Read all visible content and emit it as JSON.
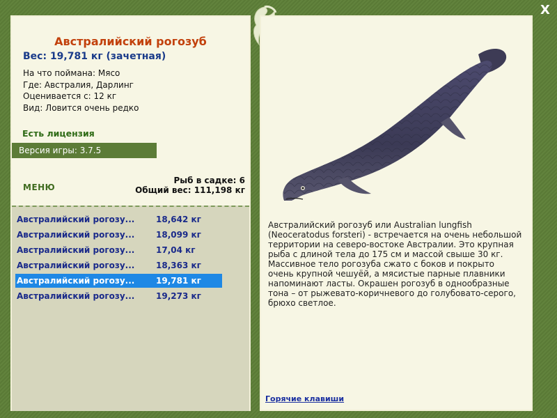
{
  "fish": {
    "title": "Австралийский рогозуб",
    "weight_line": "Вес: 19,781 кг (зачетная)",
    "caught_on": "На что поймана: Мясо",
    "where": "Где: Австралия, Дарлинг",
    "valued_from": "Оценивается с: 12 кг",
    "rarity": "Вид: Ловится очень редко"
  },
  "license": "Есть лицензия",
  "version": "Версия игры: 3.7.5",
  "menu_label": "МЕНЮ",
  "cage": {
    "count_label": "Рыб в садке: 6",
    "total_label": "Общий вес: 111,198 кг"
  },
  "catch_list": [
    {
      "name": "Австралийский рогозу...",
      "weight": "18,642 кг"
    },
    {
      "name": "Австралийский рогозу...",
      "weight": "18,099 кг"
    },
    {
      "name": "Австралийский рогозу...",
      "weight": "17,04 кг"
    },
    {
      "name": "Австралийский рогозу...",
      "weight": "18,363 кг"
    },
    {
      "name": "Австралийский рогозу...",
      "weight": "19,781 кг",
      "selected": true
    },
    {
      "name": "Австралийский рогозу...",
      "weight": "19,273 кг"
    }
  ],
  "description": "Австралийский рогозуб или Australian lungfish (Neoceratodus forsteri) - встречается на очень небольшой территории на северо-востоке Австралии. Это крупная рыба с длиной тела до 175 см и массой свыше 30 кг. Массивное тело рогозуба сжато с боков и покрыто очень крупной чешуёй, а мясистые парные плавники напоминают ласты. Окрашен рогозуб в однообразные тона – от рыжевато-коричневого до голубовато-серого, брюхо светлое.",
  "hotkeys_label": "Горячие клавиши",
  "close_label": "X",
  "colors": {
    "frame": "#5f7d3a",
    "panel": "#f7f6e4",
    "title": "#c2410c",
    "selected_row": "#1e88e5",
    "list_bg": "#d6d6bd"
  },
  "icons": [
    "close-icon",
    "fish-logo-icon"
  ]
}
